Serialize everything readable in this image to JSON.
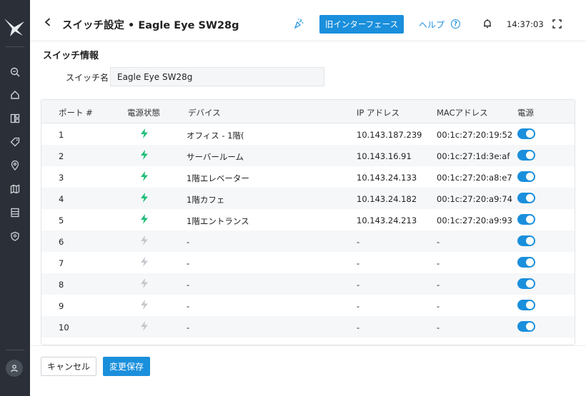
{
  "header": {
    "title": "スイッチ設定 • Eagle Eye SW28g",
    "legacy_button": "旧インターフェース",
    "help": "ヘルプ",
    "clock": "14:37:03"
  },
  "section": {
    "title": "スイッチ情報",
    "switch_name_label": "スイッチ名",
    "switch_name_value": "Eagle Eye SW28g"
  },
  "table": {
    "columns": [
      "ポート #",
      "電源状態",
      "デバイス",
      "IP アドレス",
      "MACアドレス",
      "電源"
    ],
    "rows": [
      {
        "port": "1",
        "power_active": true,
        "device": "オフィス - 1階(",
        "ip": "10.143.187.239",
        "mac": "00:1c:27:20:19:52",
        "power_on": true
      },
      {
        "port": "2",
        "power_active": true,
        "device": "サーバールーム",
        "ip": "10.143.16.91",
        "mac": "00:1c:27:1d:3e:af",
        "power_on": true
      },
      {
        "port": "3",
        "power_active": true,
        "device": "1階エレベーター",
        "ip": "10.143.24.133",
        "mac": "00:1c:27:20:a8:e7",
        "power_on": true
      },
      {
        "port": "4",
        "power_active": true,
        "device": "1階カフェ",
        "ip": "10.143.24.182",
        "mac": "00:1c:27:20:a9:74",
        "power_on": true
      },
      {
        "port": "5",
        "power_active": true,
        "device": "1階エントランス",
        "ip": "10.143.24.213",
        "mac": "00:1c:27:20:a9:93",
        "power_on": true
      },
      {
        "port": "6",
        "power_active": false,
        "device": "-",
        "ip": "-",
        "mac": "-",
        "power_on": true
      },
      {
        "port": "7",
        "power_active": false,
        "device": "-",
        "ip": "-",
        "mac": "-",
        "power_on": true
      },
      {
        "port": "8",
        "power_active": false,
        "device": "-",
        "ip": "-",
        "mac": "-",
        "power_on": true
      },
      {
        "port": "9",
        "power_active": false,
        "device": "-",
        "ip": "-",
        "mac": "-",
        "power_on": true
      },
      {
        "port": "10",
        "power_active": false,
        "device": "-",
        "ip": "-",
        "mac": "-",
        "power_on": true
      }
    ]
  },
  "footer": {
    "cancel": "キャンセル",
    "save": "変更保存"
  },
  "colors": {
    "accent": "#1a8fdc",
    "bolt_active": "#1fbf7a",
    "bolt_inactive": "#c5c9ce",
    "sidebar": "#2b3038"
  },
  "sidebar": {
    "icons": [
      "zoom-icon",
      "home-icon",
      "dashboard-icon",
      "tag-icon",
      "location-pin-icon",
      "map-icon",
      "server-icon",
      "shield-icon",
      "user-icon"
    ]
  }
}
